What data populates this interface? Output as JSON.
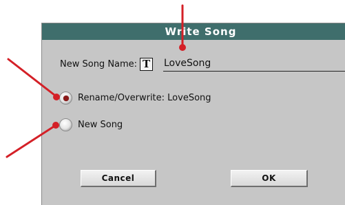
{
  "dialog": {
    "title": "Write Song",
    "name_label": "New Song Name:",
    "text_icon_glyph": "T",
    "name_value": "LoveSong"
  },
  "options": [
    {
      "label": "Rename/Overwrite: LoveSong",
      "selected": true
    },
    {
      "label": "New Song",
      "selected": false
    }
  ],
  "buttons": {
    "cancel_label": "Cancel",
    "ok_label": "OK"
  },
  "colors": {
    "titlebar": "#3f6e6c",
    "dialog_bg": "#c6c6c6",
    "callout_arrow": "#d42027",
    "radio_selected": "#8b1a1a"
  }
}
